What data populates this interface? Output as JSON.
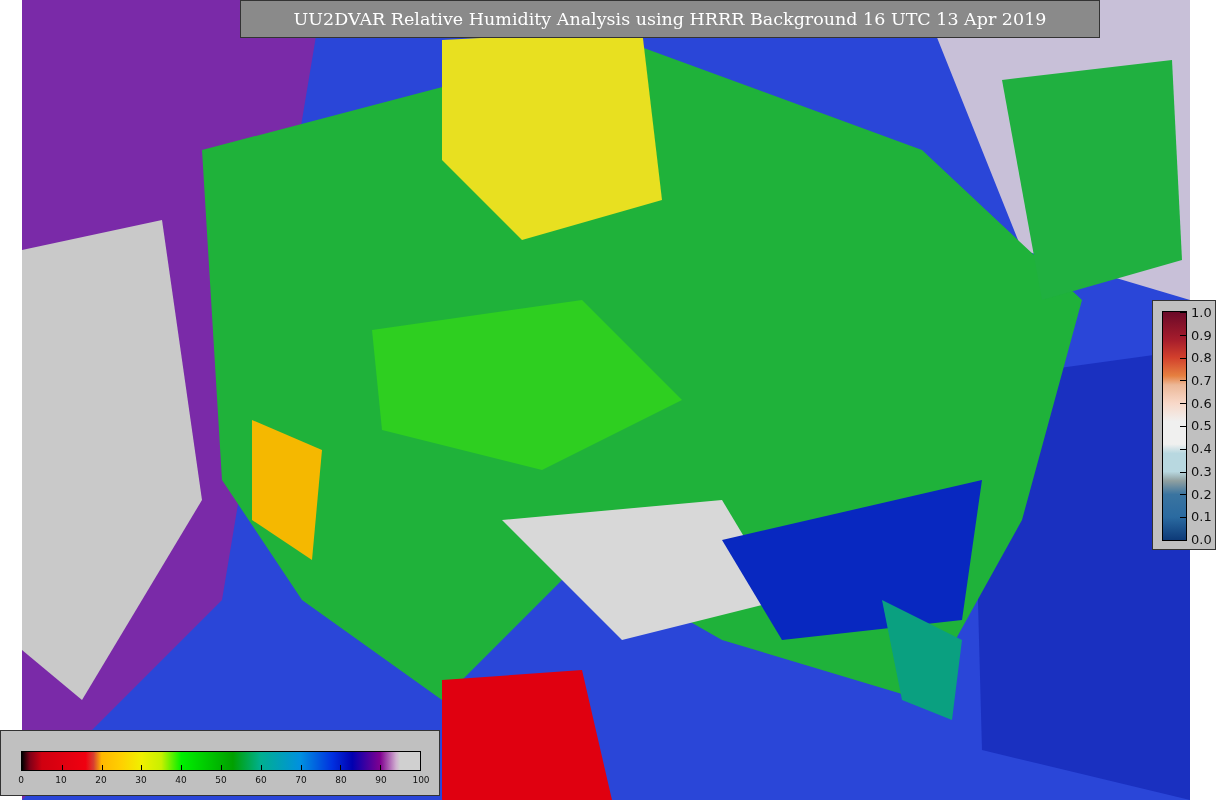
{
  "title": "UU2DVAR Relative Humidity Analysis using HRRR Background 16 UTC 13 Apr 2019",
  "humidity_colorbar": {
    "ticks": [
      "0",
      "10",
      "20",
      "30",
      "40",
      "50",
      "60",
      "70",
      "80",
      "90",
      "100"
    ]
  },
  "increment_colorbar": {
    "ticks": [
      "1.0",
      "0.9",
      "0.8",
      "0.7",
      "0.6",
      "0.5",
      "0.4",
      "0.3",
      "0.2",
      "0.1",
      "0.0"
    ]
  }
}
